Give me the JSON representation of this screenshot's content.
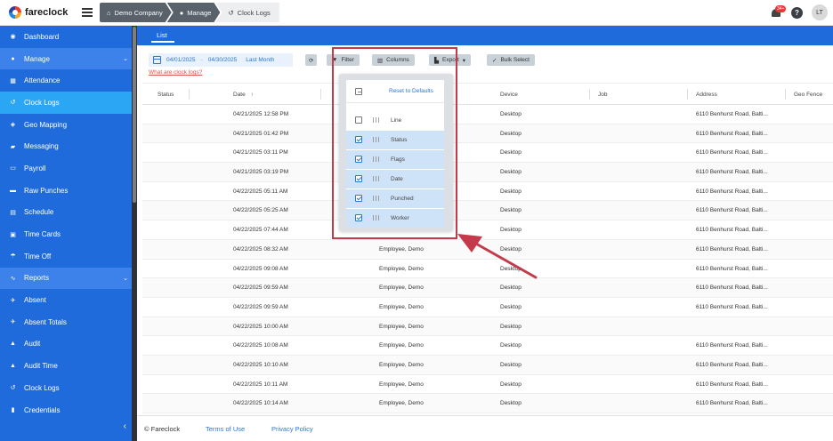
{
  "brand": {
    "name": "fareclock"
  },
  "breadcrumbs": [
    {
      "label": "Demo Company",
      "icon": "home-icon"
    },
    {
      "label": "Manage",
      "icon": "user-icon"
    },
    {
      "label": "Clock Logs",
      "icon": "history-icon"
    }
  ],
  "topbar": {
    "notification_count": "34+",
    "help_label": "?",
    "user_initials": "LT"
  },
  "sidebar": {
    "items": [
      {
        "label": "Dashboard",
        "icon": "dashboard-icon",
        "state": "normal"
      },
      {
        "label": "Manage",
        "icon": "user-icon",
        "state": "open",
        "chevron": "⌄"
      },
      {
        "label": "Attendance",
        "icon": "grid-icon",
        "state": "normal"
      },
      {
        "label": "Clock Logs",
        "icon": "history-icon",
        "state": "active"
      },
      {
        "label": "Geo Mapping",
        "icon": "map-icon",
        "state": "normal"
      },
      {
        "label": "Messaging",
        "icon": "chat-icon",
        "state": "normal"
      },
      {
        "label": "Payroll",
        "icon": "money-icon",
        "state": "normal"
      },
      {
        "label": "Raw Punches",
        "icon": "truck-icon",
        "state": "normal"
      },
      {
        "label": "Schedule",
        "icon": "calendar-icon",
        "state": "normal"
      },
      {
        "label": "Time Cards",
        "icon": "card-icon",
        "state": "normal"
      },
      {
        "label": "Time Off",
        "icon": "umbrella-icon",
        "state": "normal"
      },
      {
        "label": "Reports",
        "icon": "chart-icon",
        "state": "open",
        "chevron": "⌄"
      },
      {
        "label": "Absent",
        "icon": "plane-icon",
        "state": "normal"
      },
      {
        "label": "Absent Totals",
        "icon": "plane-icon",
        "state": "normal"
      },
      {
        "label": "Audit",
        "icon": "bank-icon",
        "state": "normal"
      },
      {
        "label": "Audit Time",
        "icon": "bank-icon",
        "state": "normal"
      },
      {
        "label": "Clock Logs",
        "icon": "history-icon",
        "state": "normal"
      },
      {
        "label": "Credentials",
        "icon": "id-icon",
        "state": "normal"
      }
    ],
    "collapse_glyph": "‹"
  },
  "tabs": [
    {
      "label": "List"
    }
  ],
  "toolbar": {
    "date_from": "04/01/2025",
    "date_sep": "-",
    "date_to": "04/30/2025",
    "period": "Last Month",
    "help_link": "What are clock logs?",
    "refresh_glyph": "⟳",
    "filter_label": "Filter",
    "columns_label": "Columns",
    "export_label": "Export",
    "export_caret": "▾",
    "bulk_select_label": "Bulk Select"
  },
  "columns_panel": {
    "reset_label": "Reset to Defaults",
    "items": [
      {
        "label": "Line",
        "checked": false
      },
      {
        "label": "Status",
        "checked": true
      },
      {
        "label": "Flags",
        "checked": true
      },
      {
        "label": "Date",
        "checked": true
      },
      {
        "label": "Punched",
        "checked": true
      },
      {
        "label": "Worker",
        "checked": true
      }
    ]
  },
  "table": {
    "headers": {
      "status": "Status",
      "date": "Date",
      "sort_glyph": "↑",
      "device": "Device",
      "job": "Job",
      "address": "Address",
      "geo_fence": "Geo Fence"
    },
    "rows": [
      {
        "date": "04/21/2025 12:58 PM",
        "worker": "",
        "device": "Desktop",
        "address": "6110 Benhurst Road, Balti..."
      },
      {
        "date": "04/21/2025 01:42 PM",
        "worker": "",
        "device": "Desktop",
        "address": "6110 Benhurst Road, Balti..."
      },
      {
        "date": "04/21/2025 03:11 PM",
        "worker": "",
        "device": "Desktop",
        "address": "6110 Benhurst Road, Balti..."
      },
      {
        "date": "04/21/2025 03:19 PM",
        "worker": "",
        "device": "Desktop",
        "address": "6110 Benhurst Road, Balti..."
      },
      {
        "date": "04/22/2025 05:11 AM",
        "worker": "",
        "device": "Desktop",
        "address": "6110 Benhurst Road, Balti..."
      },
      {
        "date": "04/22/2025 05:25 AM",
        "worker": "",
        "device": "Desktop",
        "address": "6110 Benhurst Road, Balti..."
      },
      {
        "date": "04/22/2025 07:44 AM",
        "worker": "",
        "device": "Desktop",
        "address": "6110 Benhurst Road, Balti..."
      },
      {
        "date": "04/22/2025 08:32 AM",
        "worker": "Employee, Demo",
        "device": "Desktop",
        "address": "6110 Benhurst Road, Balti..."
      },
      {
        "date": "04/22/2025 09:08 AM",
        "worker": "Employee, Demo",
        "device": "Desktop",
        "address": "6110 Benhurst Road, Balti..."
      },
      {
        "date": "04/22/2025 09:59 AM",
        "worker": "Employee, Demo",
        "device": "Desktop",
        "address": "6110 Benhurst Road, Balti..."
      },
      {
        "date": "04/22/2025 09:59 AM",
        "worker": "Employee, Demo",
        "device": "Desktop",
        "address": "6110 Benhurst Road, Balti..."
      },
      {
        "date": "04/22/2025 10:00 AM",
        "worker": "Employee, Demo",
        "device": "Desktop",
        "address": ""
      },
      {
        "date": "04/22/2025 10:08 AM",
        "worker": "Employee, Demo",
        "device": "Desktop",
        "address": "6110 Benhurst Road, Balti..."
      },
      {
        "date": "04/22/2025 10:10 AM",
        "worker": "Employee, Demo",
        "device": "Desktop",
        "address": "6110 Benhurst Road, Balti..."
      },
      {
        "date": "04/22/2025 10:11 AM",
        "worker": "Employee, Demo",
        "device": "Desktop",
        "address": "6110 Benhurst Road, Balti..."
      },
      {
        "date": "04/22/2025 10:14 AM",
        "worker": "Employee, Demo",
        "device": "Desktop",
        "address": "6110 Benhurst Road, Balti..."
      }
    ]
  },
  "footer": {
    "copyright": "© Fareclock",
    "terms": "Terms of Use",
    "privacy": "Privacy Policy"
  },
  "colors": {
    "sidebar": "#1f6bdc",
    "active": "#2aa6f4",
    "annotation": "#c53a4a"
  }
}
